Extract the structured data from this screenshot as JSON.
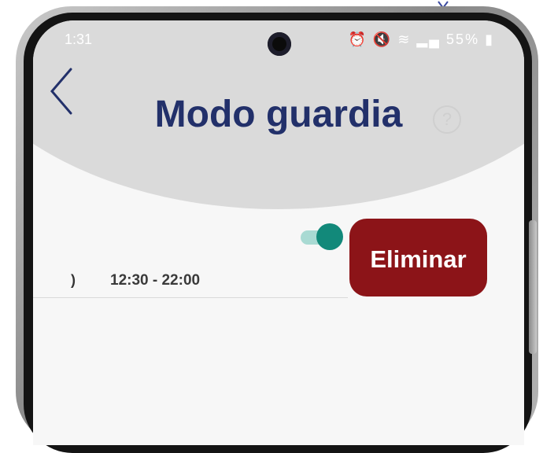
{
  "status_bar": {
    "time": "1:31",
    "icons": [
      "alarm-icon",
      "mute-icon",
      "wifi-icon",
      "signal-icon"
    ],
    "battery": "55%"
  },
  "header": {
    "title": "Modo guardia",
    "help_symbol": "?"
  },
  "schedule": {
    "day_label": ")",
    "time_range": "12:30 - 22:00",
    "enabled": true
  },
  "actions": {
    "delete_label": "Eliminar"
  },
  "colors": {
    "title": "#22306a",
    "delete_button": "#8c1418",
    "toggle_knob": "#12897a",
    "toggle_track": "#a9dad3",
    "header_bg": "#dadada"
  }
}
